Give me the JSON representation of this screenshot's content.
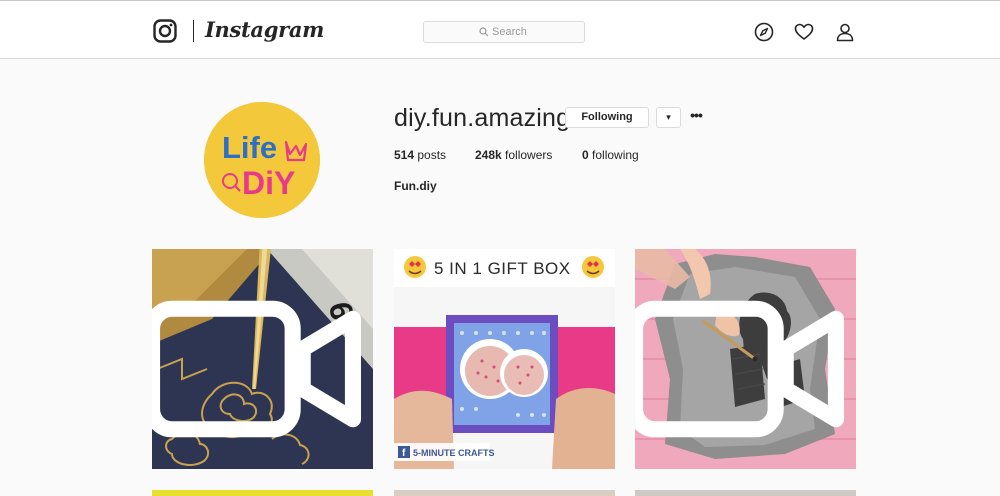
{
  "header": {
    "brand": "Instagram",
    "search_placeholder": "Search",
    "icons": [
      "instagram-glyph-icon",
      "compass-icon",
      "heart-icon",
      "person-icon",
      "search-icon"
    ]
  },
  "profile": {
    "username": "diy.fun.amazing",
    "following_button": "Following",
    "dropdown_glyph": "▾",
    "more_glyph": "•••",
    "stats": {
      "posts_count": "514",
      "posts_label": "posts",
      "followers_count": "248k",
      "followers_label": "followers",
      "following_count": "0",
      "following_label": "following"
    },
    "full_name": "Fun.diy",
    "avatar": {
      "line1": "Life",
      "line2": "DiY"
    }
  },
  "posts": [
    {
      "type": "video",
      "subject": "gold drawing on navy paper with ruler"
    },
    {
      "type": "video",
      "caption": "5 IN 1 GIFT BOX",
      "watermark": "5-MINUTE CRAFTS"
    },
    {
      "type": "video",
      "subject": "shirt painting on pink wood"
    }
  ],
  "colors": {
    "accent_text": "#262626",
    "border": "#dbdbdb",
    "background": "#fafafa",
    "avatar_yellow": "#f3c93b",
    "avatar_blue": "#2e6fc6",
    "avatar_pink": "#e8398b"
  }
}
